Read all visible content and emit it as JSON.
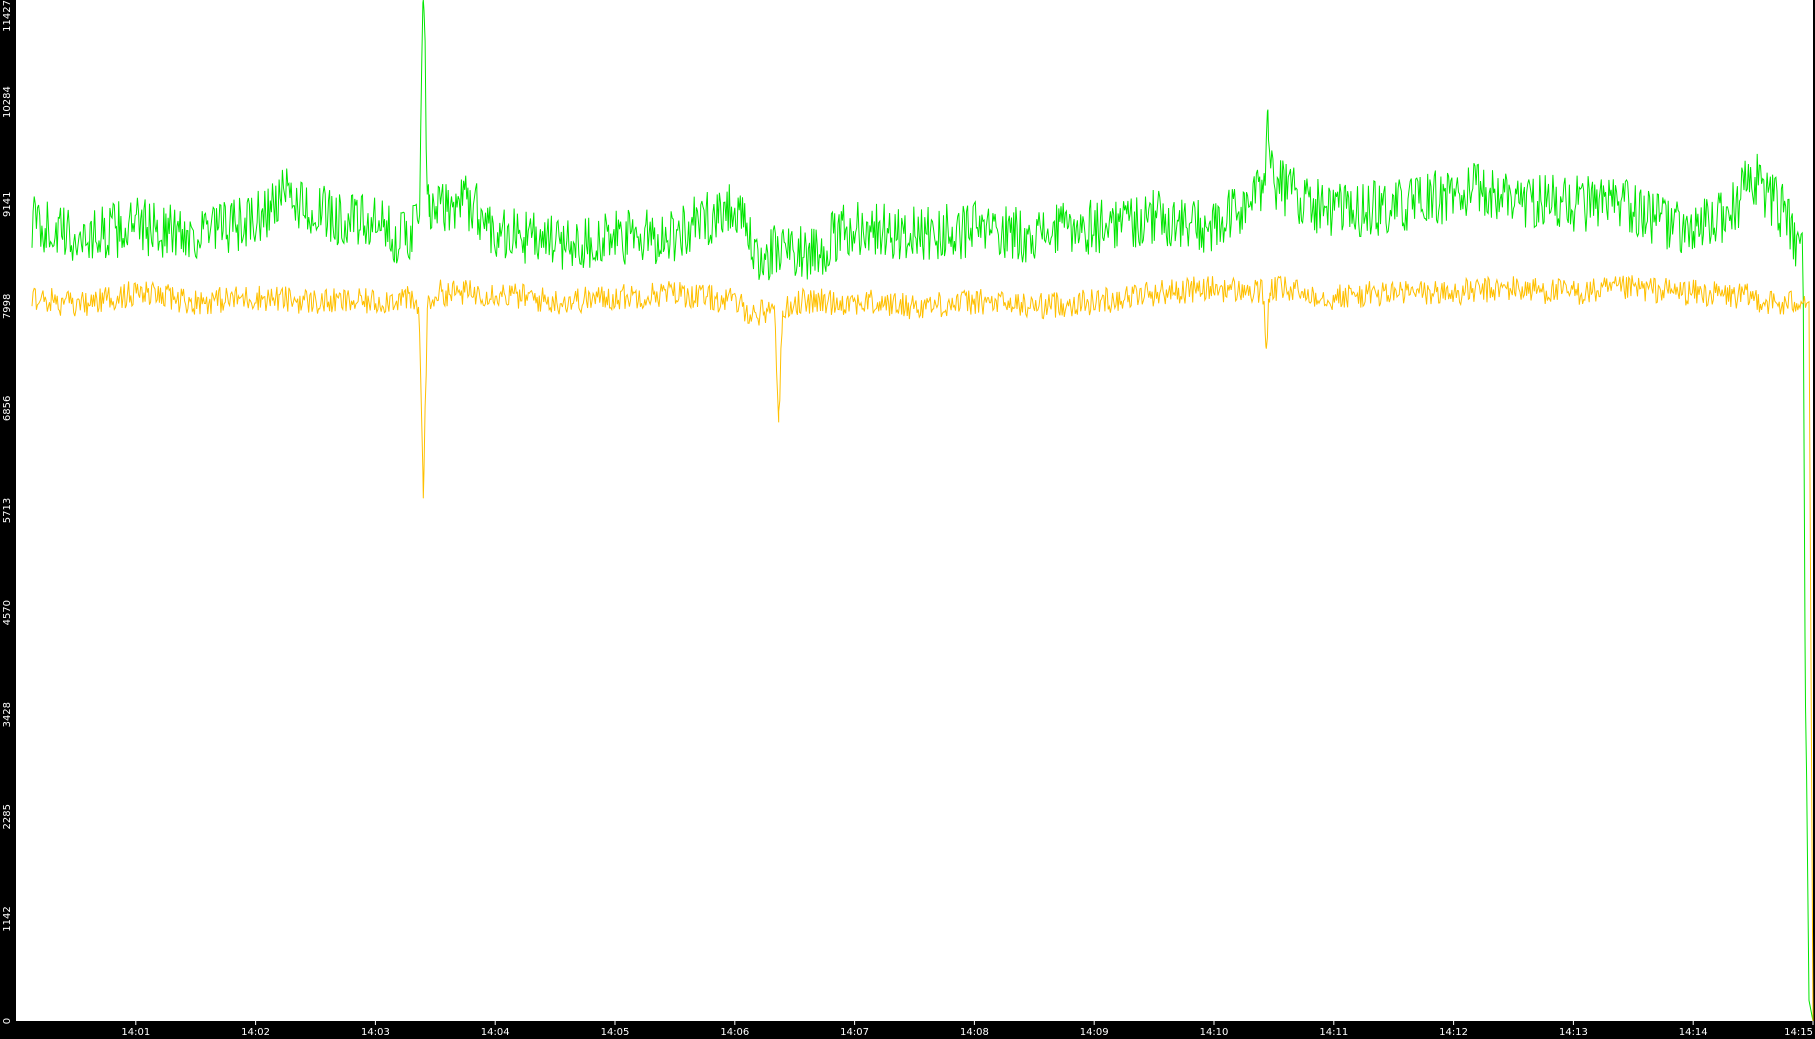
{
  "chart_data": {
    "type": "line",
    "title": "",
    "xlabel": "",
    "ylabel": "",
    "grid": false,
    "legend": "none",
    "colors": {
      "background": "#000000",
      "plot_background": "#ffffff",
      "axis_text": "#ffffff"
    },
    "ylim": [
      0,
      11427
    ],
    "yticks": [
      0,
      1142,
      2285,
      3428,
      4570,
      5713,
      6856,
      7998,
      9141,
      10284,
      11427
    ],
    "ytick_labels": [
      "0",
      "1142",
      "2285",
      "3428",
      "4570",
      "5713",
      "6856",
      "7998",
      "9141",
      "10284",
      "11427"
    ],
    "xlim": [
      "14:00",
      "14:15"
    ],
    "xticks": [
      "14:01",
      "14:02",
      "14:03",
      "14:04",
      "14:05",
      "14:06",
      "14:07",
      "14:08",
      "14:09",
      "14:10",
      "14:11",
      "14:12",
      "14:13",
      "14:14",
      "14:15"
    ],
    "xtick_labels": [
      "14:01",
      "14:02",
      "14:03",
      "14:04",
      "14:05",
      "14:06",
      "14:07",
      "14:08",
      "14:09",
      "14:10",
      "14:11",
      "14:12",
      "14:13",
      "14:14",
      "14:15"
    ],
    "series": [
      {
        "color": "#00e600",
        "x": [
          "14:00:08",
          "14:00:30",
          "14:01:00",
          "14:01:30",
          "14:02:00",
          "14:02:15",
          "14:02:30",
          "14:03:00",
          "14:03:15",
          "14:03:22",
          "14:03:24",
          "14:03:25",
          "14:03:26",
          "14:03:27",
          "14:03:30",
          "14:03:45",
          "14:04:00",
          "14:04:30",
          "14:05:00",
          "14:05:30",
          "14:06:00",
          "14:06:10",
          "14:06:30",
          "14:06:40",
          "14:07:00",
          "14:07:30",
          "14:08:00",
          "14:08:30",
          "14:09:00",
          "14:09:30",
          "14:10:00",
          "14:10:25",
          "14:10:27",
          "14:10:30",
          "14:10:45",
          "14:11:00",
          "14:11:30",
          "14:12:00",
          "14:12:15",
          "14:12:30",
          "14:13:00",
          "14:13:30",
          "14:14:00",
          "14:14:20",
          "14:14:30",
          "14:14:45",
          "14:14:53",
          "14:14:55",
          "14:14:56",
          "14:14:58",
          "14:15:00"
        ],
        "y": [
          8950,
          8750,
          8900,
          8800,
          8950,
          9250,
          9050,
          8900,
          8750,
          9000,
          11427,
          10650,
          9250,
          9000,
          9050,
          9200,
          8850,
          8700,
          8750,
          8800,
          9150,
          8550,
          8650,
          8600,
          8900,
          8800,
          8850,
          8800,
          8900,
          9000,
          8850,
          9300,
          10200,
          9400,
          9200,
          9050,
          9100,
          9250,
          9300,
          9200,
          9150,
          9100,
          8800,
          9100,
          9450,
          9050,
          8600,
          8950,
          4300,
          230,
          0
        ]
      },
      {
        "color": "#ffc000",
        "x": [
          "14:00:08",
          "14:00:30",
          "14:01:00",
          "14:01:30",
          "14:02:00",
          "14:02:30",
          "14:03:00",
          "14:03:15",
          "14:03:22",
          "14:03:24",
          "14:03:26",
          "14:03:30",
          "14:04:00",
          "14:04:30",
          "14:05:00",
          "14:05:30",
          "14:06:00",
          "14:06:10",
          "14:06:20",
          "14:06:22",
          "14:06:24",
          "14:06:30",
          "14:07:00",
          "14:07:30",
          "14:08:00",
          "14:08:30",
          "14:09:00",
          "14:09:30",
          "14:10:00",
          "14:10:25",
          "14:10:26",
          "14:10:28",
          "14:10:30",
          "14:11:00",
          "14:11:30",
          "14:12:00",
          "14:12:30",
          "14:13:00",
          "14:13:30",
          "14:14:00",
          "14:14:30",
          "14:14:45",
          "14:14:55",
          "14:14:58",
          "14:15:00"
        ],
        "y": [
          8100,
          8000,
          8150,
          8050,
          8100,
          8050,
          8050,
          8100,
          7950,
          5850,
          7950,
          8150,
          8150,
          8050,
          8100,
          8150,
          8050,
          7900,
          8000,
          6700,
          7950,
          8050,
          8050,
          8000,
          8050,
          8000,
          8050,
          8150,
          8200,
          8150,
          7550,
          8150,
          8200,
          8100,
          8150,
          8150,
          8200,
          8150,
          8200,
          8150,
          8100,
          8000,
          8100,
          8050,
          0
        ]
      }
    ]
  }
}
